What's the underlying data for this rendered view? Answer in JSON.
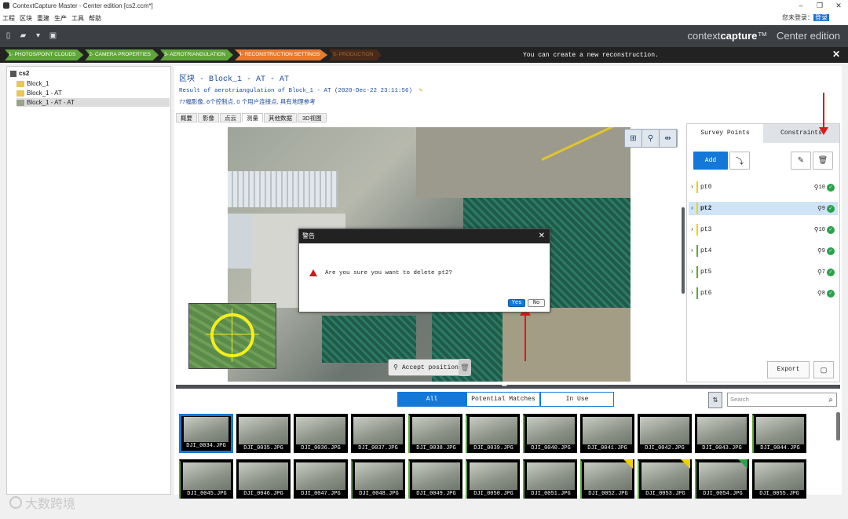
{
  "window": {
    "title": "ContextCapture Master - Center edition [cs2.ccm*]"
  },
  "menu": {
    "items": [
      "工程",
      "区块",
      "重建",
      "生产",
      "工具",
      "帮助"
    ],
    "login_label": "您未登录：",
    "login_link": "登录"
  },
  "brand": {
    "part1": "context",
    "part2": "capture",
    "tm": "™",
    "edition": "Center edition"
  },
  "workflow": {
    "steps": [
      {
        "label": "1- PHOTOS/POINT CLOUDS",
        "state": "done"
      },
      {
        "label": "2- CAMERA PROPERTIES",
        "state": "done"
      },
      {
        "label": "3- AEROTRIANGULATION",
        "state": "done"
      },
      {
        "label": "4- RECONSTRUCTION SETTINGS",
        "state": "active"
      },
      {
        "label": "5- PRODUCTION",
        "state": "next"
      }
    ],
    "message": "You can create a new reconstruction.",
    "close": "✕"
  },
  "tree": {
    "root": "cs2",
    "items": [
      "Block_1",
      "Block_1 - AT",
      "Block_1 - AT - AT"
    ]
  },
  "header": {
    "title": "区块 - Block_1 - AT - AT",
    "subtitle": "Result of aerotriangulation of Block_1 - AT (2020-Dec-22 23:11:56)",
    "stats": "77幅影像, 6个控制点, 0 个用户连接点, 具有地理参考"
  },
  "tabs": [
    "概要",
    "影像",
    "点云",
    "测量",
    "其他数据",
    "3D视图"
  ],
  "viewer": {
    "accept_label": "Accept position"
  },
  "survey": {
    "tabs": [
      "Survey Points",
      "Constraints"
    ],
    "add_label": "Add",
    "points": [
      {
        "name": "pt0",
        "count": "10",
        "color": "#f0d000",
        "selected": false
      },
      {
        "name": "pt2",
        "count": "9",
        "color": "#f0d000",
        "selected": true
      },
      {
        "name": "pt3",
        "count": "10",
        "color": "#f0d000",
        "selected": false
      },
      {
        "name": "pt4",
        "count": "9",
        "color": "#5fa63a",
        "selected": false
      },
      {
        "name": "pt5",
        "count": "7",
        "color": "#5fa63a",
        "selected": false
      },
      {
        "name": "pt6",
        "count": "8",
        "color": "#5fa63a",
        "selected": false
      }
    ],
    "export_label": "Export"
  },
  "filters": {
    "items": [
      "All",
      "Potential Matches",
      "In Use"
    ],
    "search_placeholder": "Search"
  },
  "thumbnails": [
    "DJI_0034.JPG",
    "DJI_0035.JPG",
    "DJI_0036.JPG",
    "DJI_0037.JPG",
    "DJI_0038.JPG",
    "DJI_0039.JPG",
    "DJI_0040.JPG",
    "DJI_0041.JPG",
    "DJI_0042.JPG",
    "DJI_0043.JPG",
    "DJI_0044.JPG",
    "DJI_0045.JPG",
    "DJI_0046.JPG",
    "DJI_0047.JPG",
    "DJI_0048.JPG",
    "DJI_0049.JPG",
    "DJI_0050.JPG",
    "DJI_0051.JPG",
    "DJI_0052.JPG",
    "DJI_0053.JPG",
    "DJI_0054.JPG",
    "DJI_0055.JPG"
  ],
  "dialog": {
    "title": "警告",
    "message": "Are you sure you want to delete pt2?",
    "yes": "Yes",
    "no": "No"
  },
  "watermark": "大数跨境",
  "colors": {
    "accent": "#1378d8",
    "done_step": "#5fa63a",
    "active_step": "#e87a2f",
    "warning": "#c81c1c"
  }
}
